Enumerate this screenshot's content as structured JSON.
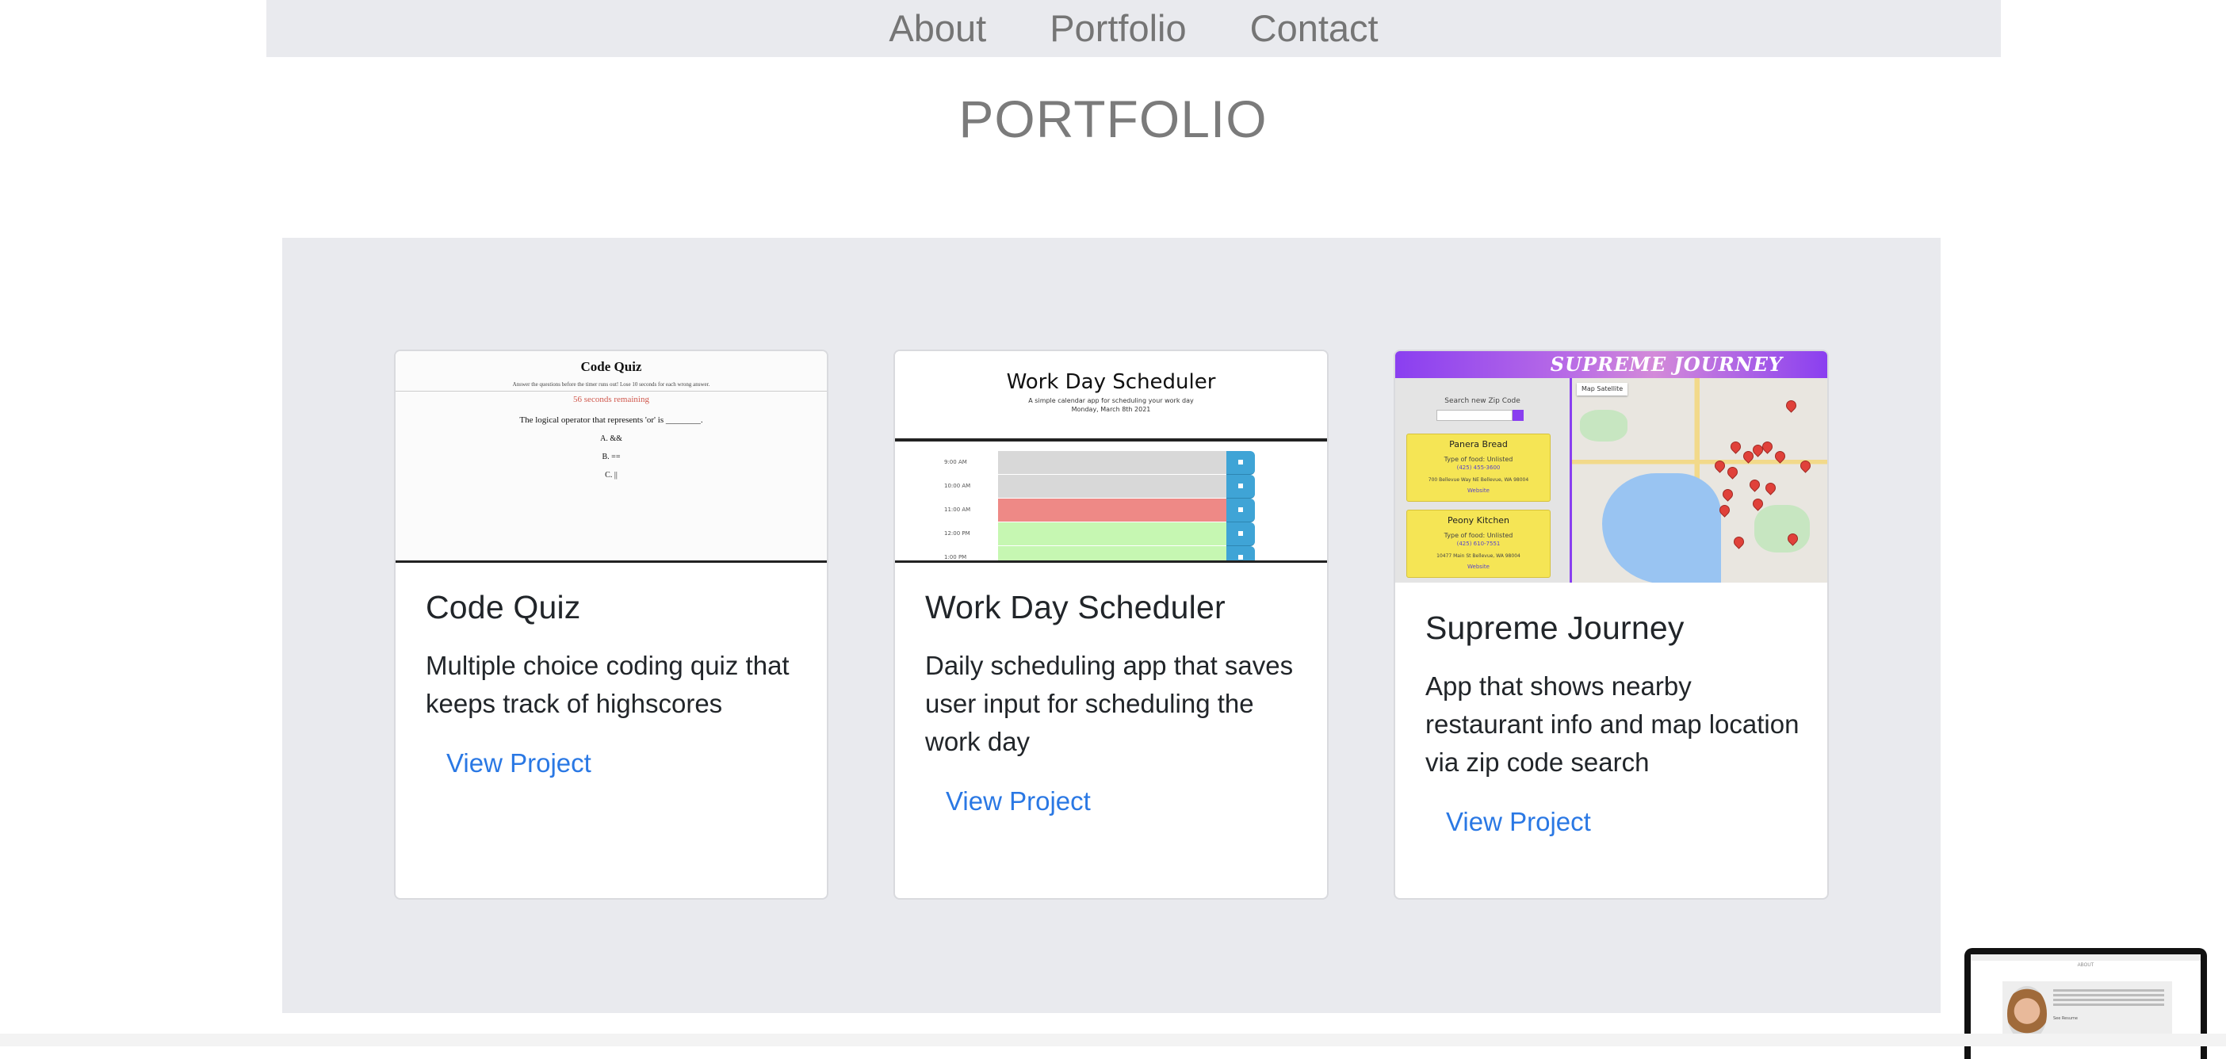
{
  "nav": {
    "items": [
      "About",
      "Portfolio",
      "Contact"
    ]
  },
  "page_title": "PORTFOLIO",
  "cards": [
    {
      "title": "Code Quiz",
      "description": "Multiple choice coding quiz that keeps track of highscores",
      "link": "View Project",
      "thumb": {
        "heading": "Code Quiz",
        "subtitle": "Answer the questions before the timer runs out! Lose 10 seconds for each wrong answer.",
        "timer": "56 seconds remaining",
        "question": "The logical operator that represents 'or' is ________.",
        "options": [
          "A. &&",
          "B. ==",
          "C. ||"
        ]
      }
    },
    {
      "title": "Work Day Scheduler",
      "description": "Daily scheduling app that saves user input for scheduling the work day",
      "link": "View Project",
      "thumb": {
        "heading": "Work Day Scheduler",
        "subtitle": "A simple calendar app for scheduling your work day",
        "date": "Monday, March 8th 2021",
        "rows": [
          {
            "time": "9:00 AM",
            "state": "past"
          },
          {
            "time": "10:00 AM",
            "state": "past"
          },
          {
            "time": "11:00 AM",
            "state": "present"
          },
          {
            "time": "12:00 PM",
            "state": "future"
          },
          {
            "time": "1:00 PM",
            "state": "future"
          }
        ]
      }
    },
    {
      "title": "Supreme Journey",
      "description": "App that shows nearby restaurant info and map location via zip code search",
      "link": "View Project",
      "thumb": {
        "banner": "SUPREME JOURNEY",
        "search_label": "Search new Zip Code",
        "map_tabs": "Map   Satellite",
        "restaurants": [
          {
            "name": "Panera Bread",
            "type": "Type of food: Unlisted",
            "phone": "(425) 455-3600",
            "address": "700 Bellevue Way NE Bellevue, WA 98004",
            "website": "Website"
          },
          {
            "name": "Peony Kitchen",
            "type": "Type of food: Unlisted",
            "phone": "(425) 610-7551",
            "address": "10477 Main St Bellevue, WA 98004",
            "website": "Website"
          }
        ]
      }
    }
  ],
  "preview": {
    "label": "ABOUT",
    "link": "See Resume"
  }
}
